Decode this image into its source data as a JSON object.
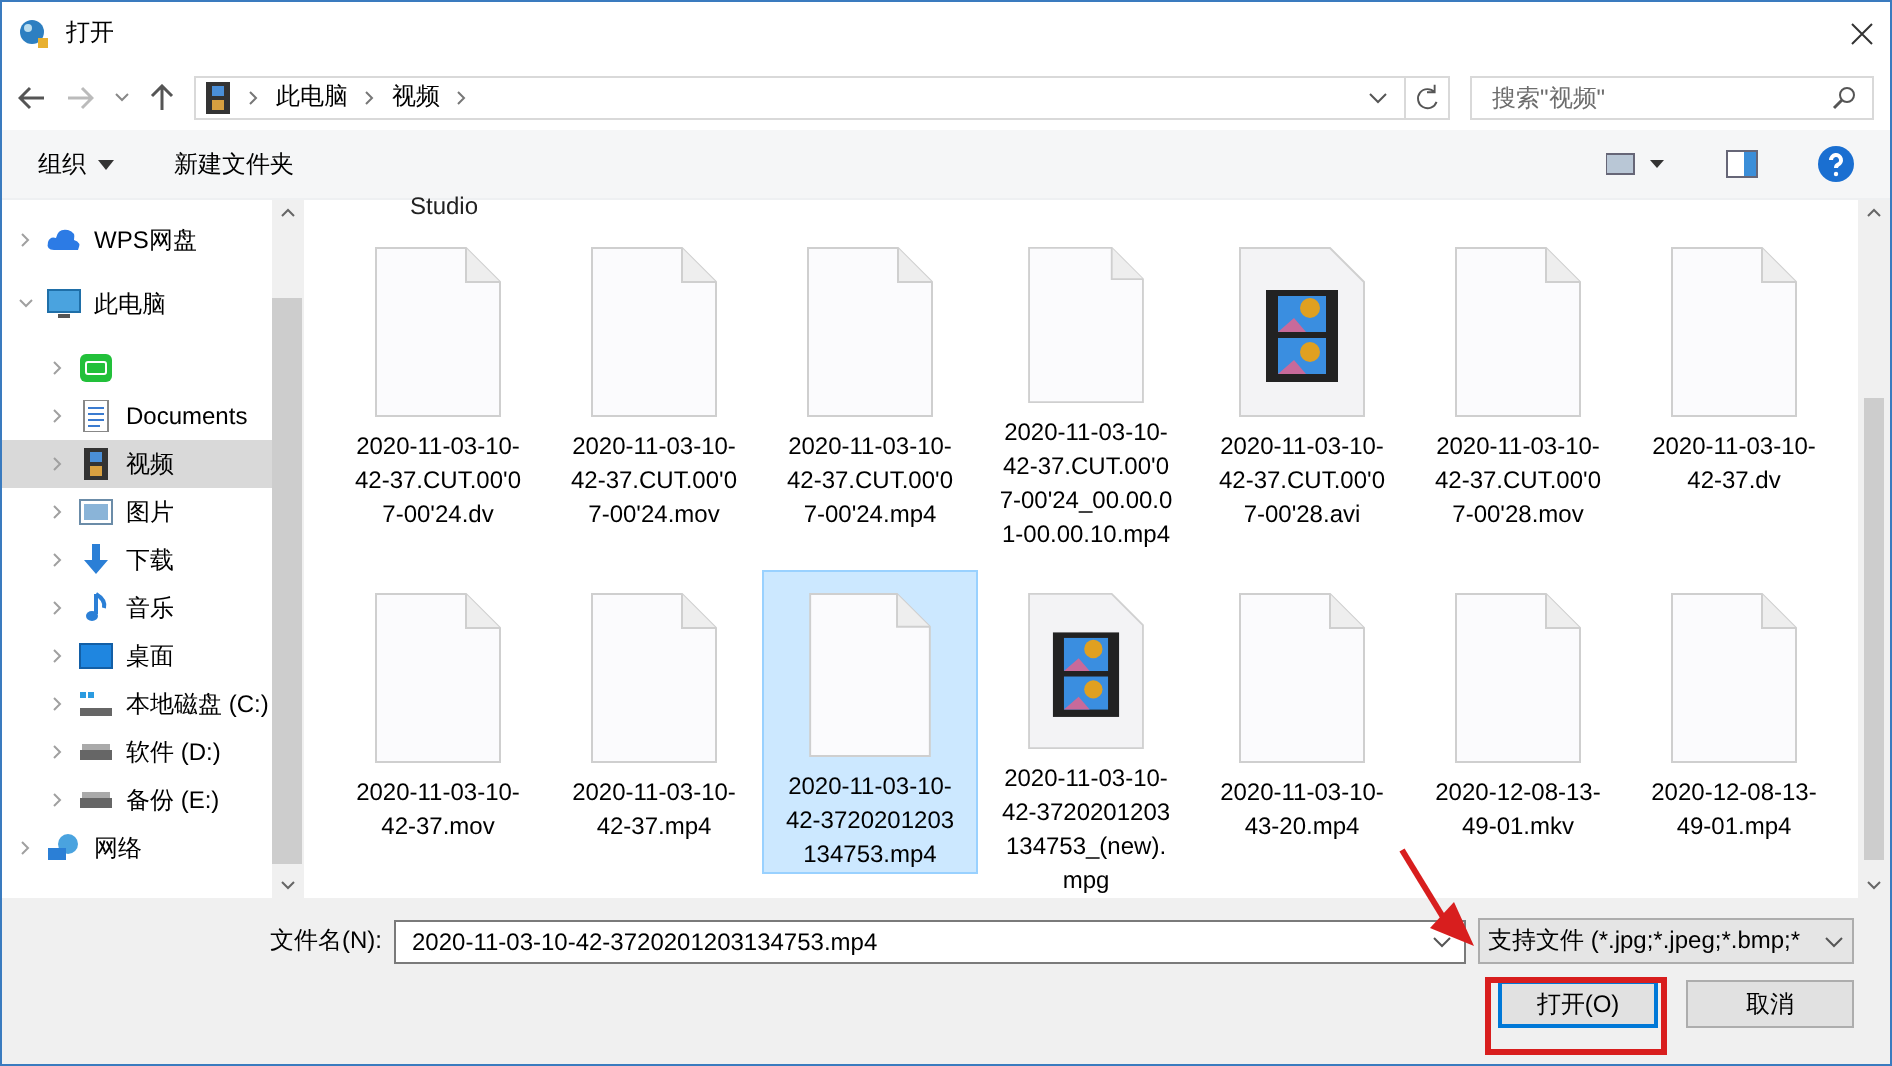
{
  "window": {
    "title": "打开"
  },
  "address": {
    "path": [
      "此电脑",
      "视频"
    ],
    "search_placeholder": "搜索\"视频\""
  },
  "toolbar": {
    "organize": "组织",
    "new_folder": "新建文件夹"
  },
  "sidebar": {
    "items": [
      {
        "label": "WPS网盘",
        "kind": "cloud",
        "selected": false,
        "expanded": false
      },
      {
        "label": "此电脑",
        "kind": "pc",
        "selected": false,
        "expanded": true,
        "children": [
          {
            "kind": "app",
            "selected": false,
            "expanded": false
          },
          {
            "label": "Documents",
            "kind": "doc",
            "selected": false,
            "expanded": false
          },
          {
            "label": "视频",
            "kind": "video",
            "selected": true,
            "expanded": false
          },
          {
            "label": "图片",
            "kind": "picture",
            "selected": false,
            "expanded": false
          },
          {
            "label": "下载",
            "kind": "download",
            "selected": false,
            "expanded": false
          },
          {
            "label": "音乐",
            "kind": "music",
            "selected": false,
            "expanded": false
          },
          {
            "label": "桌面",
            "kind": "desktop",
            "selected": false,
            "expanded": false
          },
          {
            "label": "本地磁盘 (C:)",
            "kind": "sysdrive",
            "selected": false,
            "expanded": false
          },
          {
            "label": "软件 (D:)",
            "kind": "drive",
            "selected": false,
            "expanded": false
          },
          {
            "label": "备份 (E:)",
            "kind": "drive",
            "selected": false,
            "expanded": false
          }
        ]
      },
      {
        "label": "网络",
        "kind": "network",
        "selected": false,
        "expanded": false
      }
    ]
  },
  "files": {
    "partial_label": "Studio",
    "items": [
      {
        "name": "2020-11-03-10-42-37.CUT.00'07-00'24.dv",
        "kind": "blank",
        "selected": false
      },
      {
        "name": "2020-11-03-10-42-37.CUT.00'07-00'24.mov",
        "kind": "blank",
        "selected": false
      },
      {
        "name": "2020-11-03-10-42-37.CUT.00'07-00'24.mp4",
        "kind": "blank",
        "selected": false
      },
      {
        "name": "2020-11-03-10-42-37.CUT.00'07-00'24_00.00.01-00.00.10.mp4",
        "kind": "blank",
        "selected": false
      },
      {
        "name": "2020-11-03-10-42-37.CUT.00'07-00'28.avi",
        "kind": "video",
        "selected": false
      },
      {
        "name": "2020-11-03-10-42-37.CUT.00'07-00'28.mov",
        "kind": "blank",
        "selected": false
      },
      {
        "name": "2020-11-03-10-42-37.dv",
        "kind": "blank",
        "selected": false
      },
      {
        "name": "2020-11-03-10-42-37.mov",
        "kind": "blank",
        "selected": false
      },
      {
        "name": "2020-11-03-10-42-37.mp4",
        "kind": "blank",
        "selected": false
      },
      {
        "name": "2020-11-03-10-42-3720201203134753.mp4",
        "kind": "blank",
        "selected": true
      },
      {
        "name": "2020-11-03-10-42-3720201203134753_(new).mpg",
        "kind": "video",
        "selected": false
      },
      {
        "name": "2020-11-03-10-43-20.mp4",
        "kind": "blank",
        "selected": false
      },
      {
        "name": "2020-12-08-13-49-01.mkv",
        "kind": "blank",
        "selected": false
      },
      {
        "name": "2020-12-08-13-49-01.mp4",
        "kind": "blank",
        "selected": false
      }
    ]
  },
  "footer": {
    "filename_label": "文件名(N):",
    "filename": "2020-11-03-10-42-3720201203134753.mp4",
    "filter": "支持文件 (*.jpg;*.jpeg;*.bmp;*",
    "open": "打开(O)",
    "cancel": "取消"
  }
}
